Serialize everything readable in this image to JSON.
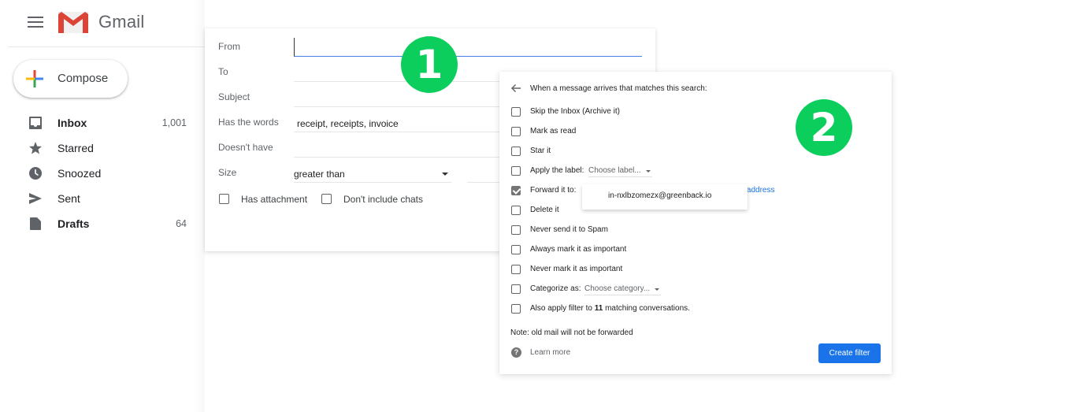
{
  "app": {
    "name": "Gmail",
    "menu_icon": "hamburger-menu-icon",
    "logo_icon": "gmail-m-logo-icon"
  },
  "compose": {
    "label": "Compose",
    "icon": "multicolor-plus-icon"
  },
  "sidebar": {
    "items": [
      {
        "label": "Inbox",
        "icon": "inbox-icon",
        "count": "1,001",
        "bold": true
      },
      {
        "label": "Starred",
        "icon": "star-icon",
        "count": "",
        "bold": false
      },
      {
        "label": "Snoozed",
        "icon": "clock-icon",
        "count": "",
        "bold": false
      },
      {
        "label": "Sent",
        "icon": "send-icon",
        "count": "",
        "bold": false
      },
      {
        "label": "Drafts",
        "icon": "draft-file-icon",
        "count": "64",
        "bold": true
      }
    ]
  },
  "search_form": {
    "from": {
      "label": "From",
      "value": ""
    },
    "to": {
      "label": "To",
      "value": ""
    },
    "subject": {
      "label": "Subject",
      "value": ""
    },
    "has_words": {
      "label": "Has the words",
      "value": "receipt, receipts, invoice"
    },
    "doesnt_have": {
      "label": "Doesn't have",
      "value": ""
    },
    "size": {
      "label": "Size",
      "selected": "greater than",
      "value": ""
    },
    "has_attachment": {
      "label": "Has attachment",
      "checked": false
    },
    "dont_include_chats": {
      "label": "Don't include chats",
      "checked": false
    }
  },
  "badges": {
    "step1": "1",
    "step2": "2",
    "color": "#0cce5c"
  },
  "filter_actions": {
    "title": "When a message arrives that matches this search:",
    "back_icon": "arrow-left-icon",
    "options": [
      {
        "label": "Skip the Inbox (Archive it)",
        "checked": false
      },
      {
        "label": "Mark as read",
        "checked": false
      },
      {
        "label": "Star it",
        "checked": false
      },
      {
        "label": "Apply the label:",
        "checked": false,
        "dropdown": "Choose label..."
      },
      {
        "label": "Forward it to:",
        "checked": true,
        "link": "ng address"
      },
      {
        "label": "Delete it",
        "checked": false
      },
      {
        "label": "Never send it to Spam",
        "checked": false
      },
      {
        "label": "Always mark it as important",
        "checked": false
      },
      {
        "label": "Never mark it as important",
        "checked": false
      },
      {
        "label": "Categorize as:",
        "checked": false,
        "dropdown": "Choose category..."
      },
      {
        "label_prefix": "Also apply filter to ",
        "label_count": "11",
        "label_suffix": " matching conversations.",
        "checked": false
      }
    ],
    "forward_popup_option": "in-nxlbzomezx@greenback.io",
    "note": "Note: old mail will not be forwarded",
    "learn_more": "Learn more",
    "help_icon": "question-circle-icon",
    "create_button": "Create filter",
    "accent_color": "#1a73e8"
  }
}
